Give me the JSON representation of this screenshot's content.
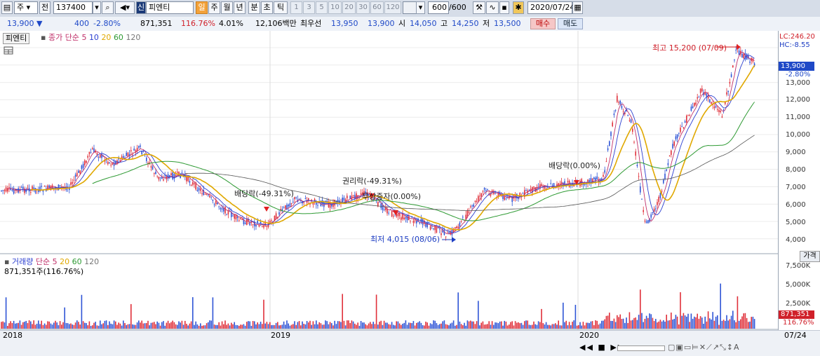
{
  "toolbar": {
    "market": "주",
    "jeon": "전",
    "code": "137400",
    "sin": "신",
    "name": "피엔티",
    "period_active": "일",
    "periods": [
      "주",
      "월",
      "년",
      "분",
      "초",
      "틱"
    ],
    "intervals": [
      "1",
      "3",
      "5",
      "10",
      "20",
      "30",
      "60",
      "120"
    ],
    "count": "600",
    "count_total": "/600",
    "date": "2020/07/24"
  },
  "quote": {
    "price": "13,900",
    "change": "400",
    "change_pct": "-2.80%",
    "volume": "871,351",
    "vol_ratio": "116.76%",
    "turnover": "4.01%",
    "amount": "12,106백만",
    "best_ask_label": "최우선",
    "best_ask": "13,950",
    "best_bid": "13,900",
    "open_label": "시",
    "open": "14,050",
    "high_label": "고",
    "high": "14,250",
    "low_label": "저",
    "low": "13,500",
    "buy": "매수",
    "sell": "매도"
  },
  "price_panel": {
    "tag": "피엔티",
    "legend_name": "종가 단순",
    "ma": [
      "5",
      "10",
      "20",
      "60",
      "120"
    ],
    "ma_colors": [
      "#c0306a",
      "#2b3fd0",
      "#e0a800",
      "#2e9a33",
      "#555555"
    ],
    "lc": "LC:246.20",
    "hc": "HC:-8.55",
    "axis_current": "13,900",
    "axis_current_pct": "-2.80%",
    "axis_labels": [
      "13,000",
      "12,000",
      "11,000",
      "10,000",
      "9,000",
      "8,000",
      "7,000",
      "6,000",
      "5,000",
      "4,000"
    ],
    "annot_high": "최고 15,200 (07/09)",
    "annot_low": "최저 4,015 (08/06)",
    "annot_div1": "배당락(-49.31%)",
    "annot_rights": "권리락(-49.31%)",
    "annot_bonus": "무상증자(0.00%)",
    "annot_div2": "배당락(0.00%)",
    "side_btn": "가격"
  },
  "volume_panel": {
    "title": "거래량",
    "legend_name": "단순",
    "ma": [
      "5",
      "20",
      "60",
      "120"
    ],
    "value_line": "871,351주(116.76%)",
    "axis_labels": [
      "7,500K",
      "5,000K",
      "2,500K"
    ],
    "axis_current": "871,351",
    "axis_current_pct": "116.76%"
  },
  "xaxis": {
    "labels": [
      "2018",
      "2019",
      "2020"
    ],
    "end_date": "07/24"
  }
}
